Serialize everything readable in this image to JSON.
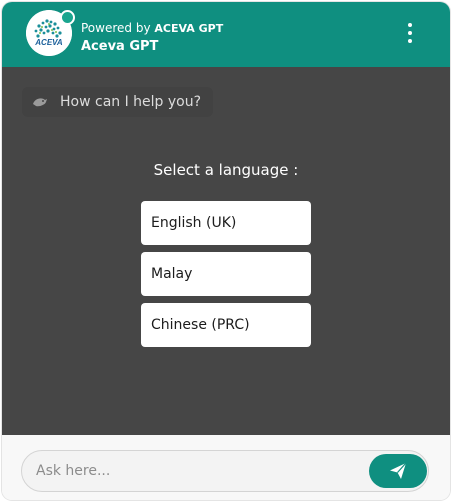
{
  "header": {
    "powered_prefix": "Powered by",
    "powered_brand": "ACEVA GPT",
    "title": "Aceva GPT",
    "logo_text": "ACEVA",
    "menu_icon": "kebab-menu-icon",
    "accent_color": "#0f8f80"
  },
  "chat": {
    "bot_icon": "bot-avatar-icon",
    "bot_message": "How can I help you?",
    "language_prompt": "Select a language :",
    "languages": [
      "English (UK)",
      "Malay",
      "Chinese (PRC)"
    ]
  },
  "composer": {
    "placeholder": "Ask here...",
    "send_icon": "send-icon"
  }
}
